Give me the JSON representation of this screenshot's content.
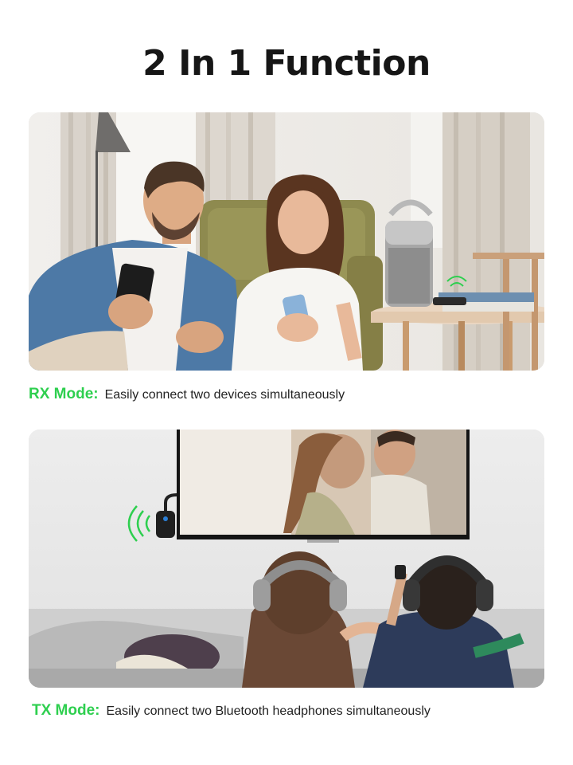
{
  "title": "2 In 1 Function",
  "accent_color": "#2ecf4f",
  "sections": [
    {
      "mode_label": "RX Mode:",
      "description": "Easily connect two devices simultaneously",
      "image_icon": "living-room-photo"
    },
    {
      "mode_label": "TX Mode:",
      "description": "Easily connect two Bluetooth headphones simultaneously",
      "image_icon": "tv-headphones-photo"
    }
  ]
}
